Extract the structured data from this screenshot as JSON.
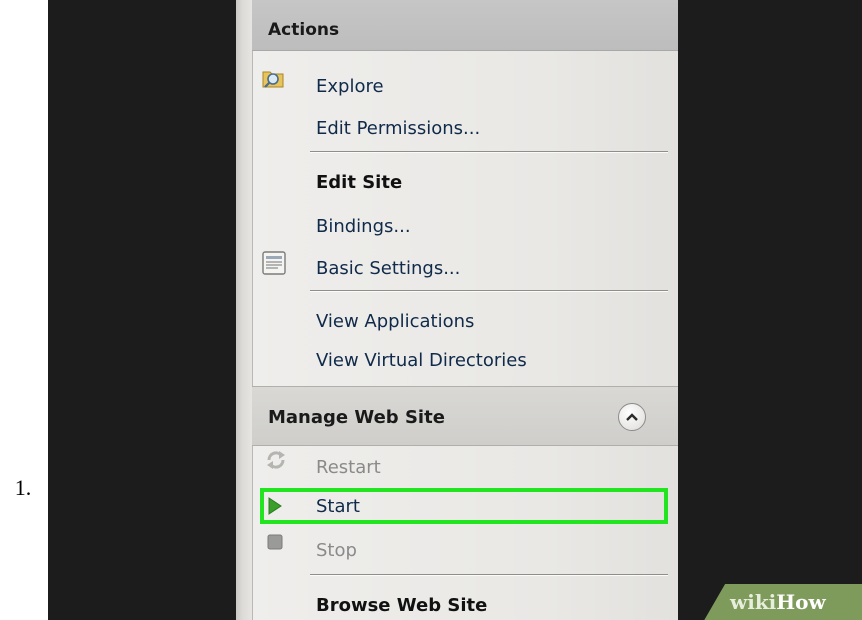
{
  "list_marker": "1.",
  "actions": {
    "header": "Actions",
    "items": [
      {
        "label": "Explore",
        "icon": "explore-folder-icon"
      },
      {
        "label": "Edit Permissions..."
      },
      {
        "label": "Edit Site",
        "style": "section-heading"
      },
      {
        "label": "Bindings..."
      },
      {
        "label": "Basic Settings...",
        "icon": "settings-document-icon"
      },
      {
        "label": "View Applications"
      },
      {
        "label": "View Virtual Directories"
      }
    ]
  },
  "manage_web_site": {
    "header": "Manage Web Site",
    "collapse_icon": "chevron-up-icon",
    "items": [
      {
        "label": "Restart",
        "icon": "restart-icon",
        "state": "disabled"
      },
      {
        "label": "Start",
        "icon": "play-icon",
        "state": "highlighted"
      },
      {
        "label": "Stop",
        "icon": "stop-icon",
        "state": "disabled"
      },
      {
        "label": "Browse Web Site",
        "style": "section-heading"
      }
    ]
  },
  "watermark": {
    "part1": "wiki",
    "part2": "How"
  },
  "colors": {
    "highlight": "#22e51f",
    "start_icon": "#3a9e2a",
    "watermark_bg": "#7e9b5c"
  }
}
